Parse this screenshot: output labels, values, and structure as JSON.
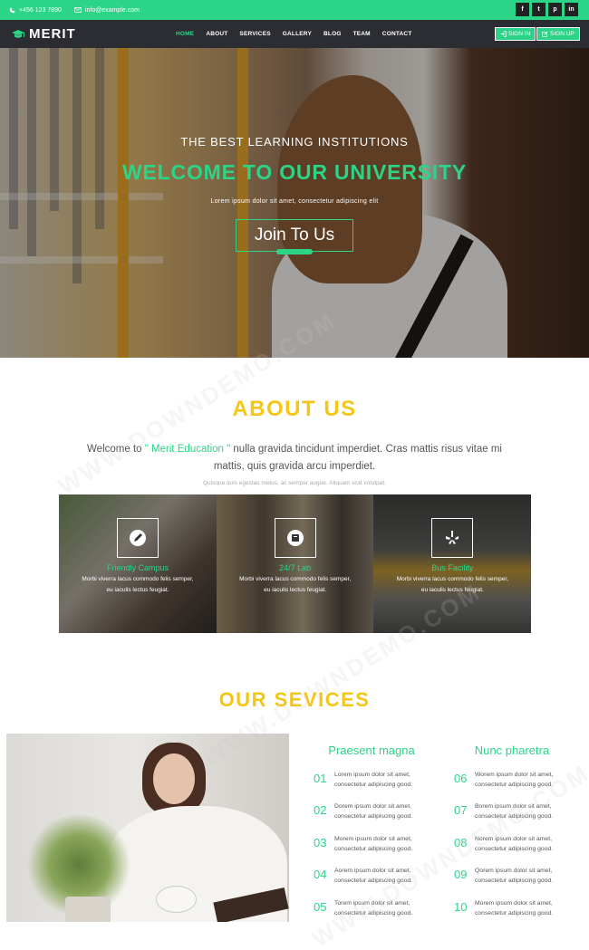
{
  "topbar": {
    "phone": "+456 123 7890",
    "email": "info@example.com",
    "social": [
      "f",
      "t",
      "p",
      "in"
    ],
    "colors": {
      "accent": "#2bd487",
      "dark": "#2b2d33",
      "yellow": "#f5c518"
    }
  },
  "nav": {
    "logo": "MERIT",
    "items": [
      "HOME",
      "ABOUT",
      "SERVICES",
      "GALLERY",
      "BLOG",
      "TEAM",
      "CONTACT"
    ],
    "signin": "SIGN IN",
    "signup": "SIGN UP"
  },
  "hero": {
    "kicker": "THE BEST LEARNING INSTITUTIONS",
    "title": "WELCOME TO OUR UNIVERSITY",
    "subtitle": "Lorem ipsum dolor sit amet, consectetur adipiscing elit",
    "button": "Join To Us"
  },
  "about": {
    "title": "ABOUT US",
    "text_pre": "Welcome to ",
    "text_highlight": "\" Merit Education \"",
    "text_post": " nulla gravida tincidunt imperdiet. Cras mattis risus vitae mi mattis, quis gravida arcu imperdiet.",
    "small": "Quisque quis egestas metus, ac semper augue. Aliquam erat volutpat.",
    "panels": [
      {
        "title": "Friendly Campus",
        "text": "Morbi viverra lacus commodo felis semper, eu iaculis lectus feugiat.",
        "icon": "pencil-icon"
      },
      {
        "title": "24/7 Lab",
        "text": "Morbi viverra lacus commodo felis semper, eu iaculis lectus feugiat.",
        "icon": "book-icon"
      },
      {
        "title": "Bus Facility",
        "text": "Morbi viverra lacus commodo felis semper, eu iaculis lectus feugiat.",
        "icon": "yelp-icon"
      }
    ]
  },
  "services": {
    "title": "OUR SEVICES",
    "col1_title": "Praesent magna",
    "col2_title": "Nunc pharetra",
    "col1": [
      {
        "num": "01",
        "line1": "Lorem ipsum dolor sit amet,",
        "line2": "consectetur adipiscing good."
      },
      {
        "num": "02",
        "line1": "Dorem ipsum dolor sit amet,",
        "line2": "consectetur adipiscing good."
      },
      {
        "num": "03",
        "line1": "Morem ipsum dolor sit amet,",
        "line2": "consectetur adipiscing good."
      },
      {
        "num": "04",
        "line1": "Aorem ipsum dolor sit amet,",
        "line2": "consectetur adipiscing good."
      },
      {
        "num": "05",
        "line1": "Torem ipsum dolor sit amet,",
        "line2": "consectetur adipiscing good."
      }
    ],
    "col2": [
      {
        "num": "06",
        "line1": "Worem ipsum dolor sit amet,",
        "line2": "consectetur adipiscing good."
      },
      {
        "num": "07",
        "line1": "Borem ipsum dolor sit amet,",
        "line2": "consectetur adipiscing good."
      },
      {
        "num": "08",
        "line1": "Norem ipsum dolor sit amet,",
        "line2": "consectetur adipiscing good."
      },
      {
        "num": "09",
        "line1": "Qorem ipsum dolor sit amet,",
        "line2": "consectetur adipiscing good."
      },
      {
        "num": "10",
        "line1": "Morem ipsum dolor sit amet,",
        "line2": "consectetur adipiscing good."
      }
    ]
  },
  "watermark": "WWW.DOWNDEMO.COM"
}
